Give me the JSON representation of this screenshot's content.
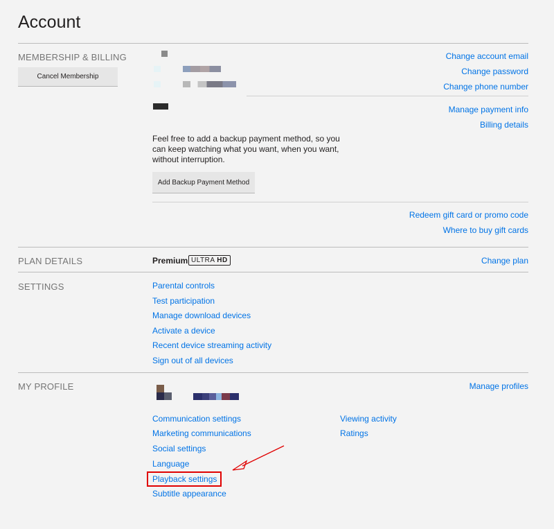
{
  "page": {
    "title": "Account"
  },
  "membership": {
    "label": "MEMBERSHIP & BILLING",
    "cancel_button": "Cancel Membership",
    "links": [
      "Change account email",
      "Change password",
      "Change phone number"
    ],
    "payment_links": [
      "Manage payment info",
      "Billing details"
    ],
    "backup_note": "Feel free to add a backup payment method, so you can keep watching what you want, when you want, without interruption.",
    "backup_button": "Add Backup Payment Method",
    "gift_links": [
      "Redeem gift card or promo code",
      "Where to buy gift cards"
    ]
  },
  "plan": {
    "label": "PLAN DETAILS",
    "name": "Premium",
    "badge_prefix": "ULTRA",
    "badge_suffix": "HD",
    "change_link": "Change plan"
  },
  "settings": {
    "label": "SETTINGS",
    "links": [
      "Parental controls",
      "Test participation",
      "Manage download devices",
      "Activate a device",
      "Recent device streaming activity",
      "Sign out of all devices"
    ]
  },
  "profile": {
    "label": "MY PROFILE",
    "manage_link": "Manage profiles",
    "left_links": [
      "Communication settings",
      "Marketing communications",
      "Social settings",
      "Language",
      "Playback settings",
      "Subtitle appearance"
    ],
    "right_links": [
      "Viewing activity",
      "Ratings"
    ]
  },
  "colors": {
    "link": "#0073e6",
    "highlight": "#e00000"
  }
}
